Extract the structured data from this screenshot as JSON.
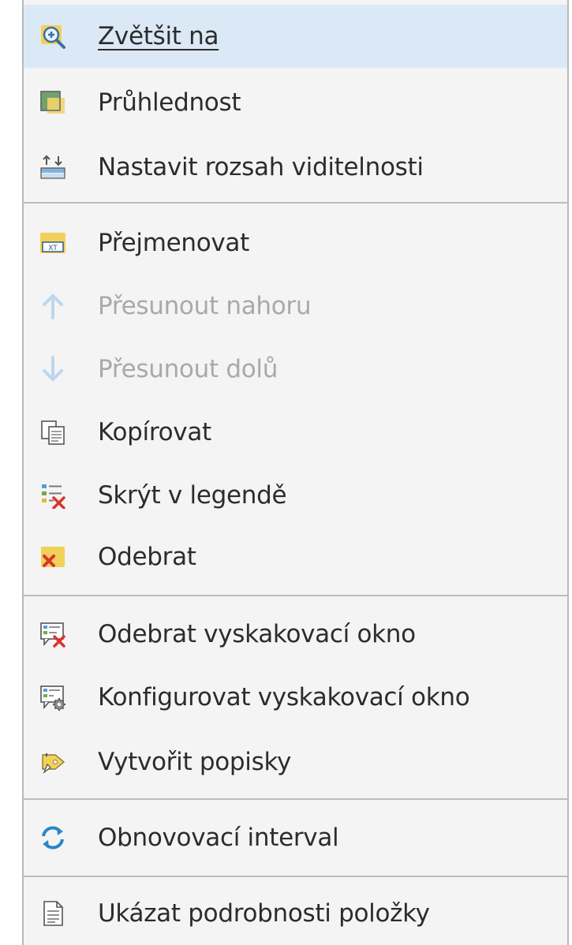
{
  "menu": {
    "items": [
      {
        "label": "Zvětšit na",
        "icon": "zoom-in-icon",
        "state": "hover"
      },
      {
        "label": "Průhlednost",
        "icon": "transparency-icon"
      },
      {
        "label": "Nastavit rozsah viditelnosti",
        "icon": "visibility-range-icon"
      },
      {
        "label": "Přejmenovat",
        "icon": "rename-icon"
      },
      {
        "label": "Přesunout nahoru",
        "icon": "arrow-up-icon",
        "state": "disabled"
      },
      {
        "label": "Přesunout dolů",
        "icon": "arrow-down-icon",
        "state": "disabled"
      },
      {
        "label": "Kopírovat",
        "icon": "copy-icon"
      },
      {
        "label": "Skrýt v legendě",
        "icon": "hide-legend-icon"
      },
      {
        "label": "Odebrat",
        "icon": "remove-icon"
      },
      {
        "label": "Odebrat vyskakovací okno",
        "icon": "remove-popup-icon"
      },
      {
        "label": "Konfigurovat vyskakovací okno",
        "icon": "configure-popup-icon"
      },
      {
        "label": "Vytvořit popisky",
        "icon": "create-labels-icon"
      },
      {
        "label": "Obnovovací interval",
        "icon": "refresh-icon"
      },
      {
        "label": "Ukázat podrobnosti položky",
        "icon": "item-details-icon"
      }
    ]
  },
  "colors": {
    "hover_bg": "#dbe9f6",
    "menu_bg": "#f4f4f4",
    "disabled_text": "#a9a9a9",
    "refresh_blue": "#2a86c8",
    "remove_red": "#d9342b"
  }
}
